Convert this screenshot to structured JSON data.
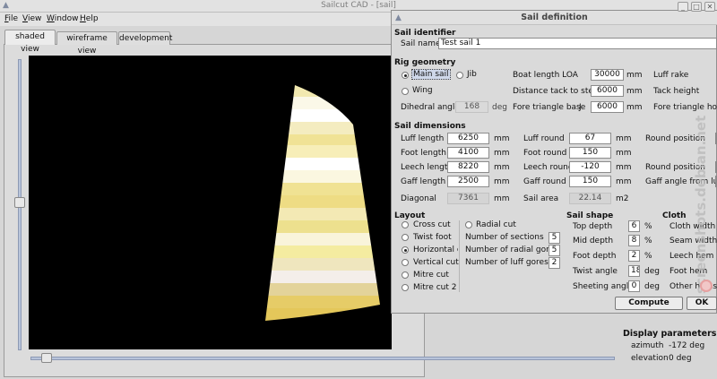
{
  "main_window": {
    "title": "Sailcut CAD - [sail]",
    "menu": [
      "File",
      "View",
      "Window",
      "Help"
    ],
    "tabs": [
      "shaded view",
      "wireframe view",
      "development"
    ]
  },
  "display_parameters": {
    "title": "Display parameters",
    "azimuth_label": "azimuth",
    "azimuth_value": "-172 deg",
    "elevation_label": "elevation",
    "elevation_value": "0 deg"
  },
  "watermark": "screenshots.debian.net",
  "dialog": {
    "title": "Sail definition",
    "sail_identifier": {
      "section": "Sail identifier",
      "name_label": "Sail name",
      "name_value": "Test sail 1"
    },
    "rig_geometry": {
      "section": "Rig geometry",
      "main_sail": "Main sail",
      "jib": "Jib",
      "wing": "Wing",
      "dihedral_label": "Dihedral angle",
      "dihedral_value": "168",
      "dihedral_unit": "deg",
      "boat_length_label": "Boat length LOA",
      "boat_length_value": "30000",
      "boat_length_unit": "mm",
      "tack_stem_label": "Distance tack to stem",
      "tack_stem_value": "6000",
      "tack_stem_unit": "mm",
      "fore_base_label": "Fore triangle base",
      "fore_base_j": "J",
      "fore_base_value": "6000",
      "fore_base_unit": "mm",
      "luff_rake": "Luff rake",
      "tack_height": "Tack height",
      "fore_hoist": "Fore triangle hoist"
    },
    "sail_dimensions": {
      "section": "Sail dimensions",
      "luff_length_label": "Luff length",
      "luff_length_value": "6250",
      "foot_length_label": "Foot length",
      "foot_length_value": "4100",
      "leech_length_label": "Leech length",
      "leech_length_value": "8220",
      "gaff_length_label": "Gaff length",
      "gaff_length_value": "2500",
      "diagonal_label": "Diagonal",
      "diagonal_value": "7361",
      "luff_round_label": "Luff round",
      "luff_round_value": "67",
      "foot_round_label": "Foot round",
      "foot_round_value": "150",
      "leech_round_label": "Leech round",
      "leech_round_value": "-120",
      "gaff_round_label": "Gaff round",
      "gaff_round_value": "150",
      "sail_area_label": "Sail area",
      "sail_area_value": "22.14",
      "sail_area_unit": "m2",
      "unit": "mm",
      "round_position_1": "Round position",
      "round_position_2": "Round position",
      "gaff_angle_luff": "Gaff angle from luff"
    },
    "layout": {
      "section": "Layout",
      "options": [
        "Cross cut",
        "Twist foot",
        "Horizontal cut",
        "Vertical cut",
        "Mitre cut",
        "Mitre cut 2"
      ],
      "radial_cut": "Radial cut",
      "sections_label": "Number of sections",
      "sections_value": "5",
      "radial_gores_label": "Number of radial gores",
      "radial_gores_value": "5",
      "luff_gores_label": "Number of luff gores",
      "luff_gores_value": "2"
    },
    "sail_shape": {
      "section": "Sail shape",
      "top_depth_label": "Top depth",
      "top_depth_value": "6",
      "top_depth_unit": "%",
      "mid_depth_label": "Mid depth",
      "mid_depth_value": "8",
      "mid_depth_unit": "%",
      "foot_depth_label": "Foot depth",
      "foot_depth_value": "2",
      "foot_depth_unit": "%",
      "twist_label": "Twist angle",
      "twist_value": "18",
      "twist_unit": "deg",
      "sheeting_label": "Sheeting angle",
      "sheeting_value": "0",
      "sheeting_unit": "deg"
    },
    "cloth": {
      "section": "Cloth",
      "cloth_width": "Cloth width",
      "seam_width": "Seam width",
      "leech_hem": "Leech hem",
      "foot_hem": "Foot hem",
      "other_hems": "Other hems"
    },
    "buttons": {
      "compute": "Compute",
      "ok": "OK"
    }
  }
}
